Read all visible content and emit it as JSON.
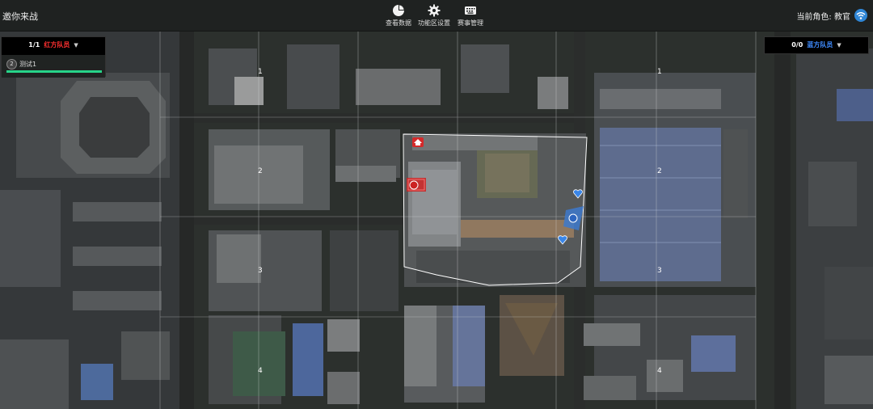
{
  "header": {
    "title": "邀你来战",
    "role_label": "当前角色:",
    "role_value": "教官"
  },
  "toolbar": [
    {
      "label": "查看数据",
      "icon": "pie-chart-icon"
    },
    {
      "label": "功能区设置",
      "icon": "gear-icon"
    },
    {
      "label": "赛事管理",
      "icon": "keyboard-icon"
    }
  ],
  "red_panel": {
    "count": "1/1",
    "team": "红方队员",
    "members": [
      {
        "num": "2",
        "name": "测试1",
        "hp": 1.0
      }
    ]
  },
  "blue_panel": {
    "count": "0/0",
    "team": "蓝方队员"
  },
  "zones": {
    "left": [
      "1",
      "2",
      "3",
      "4"
    ],
    "right": [
      "1",
      "2",
      "3",
      "4"
    ]
  },
  "colors": {
    "red": "#ff3030",
    "blue": "#3f8cff",
    "hp": "#27d489",
    "topbar": "#1f2221"
  }
}
